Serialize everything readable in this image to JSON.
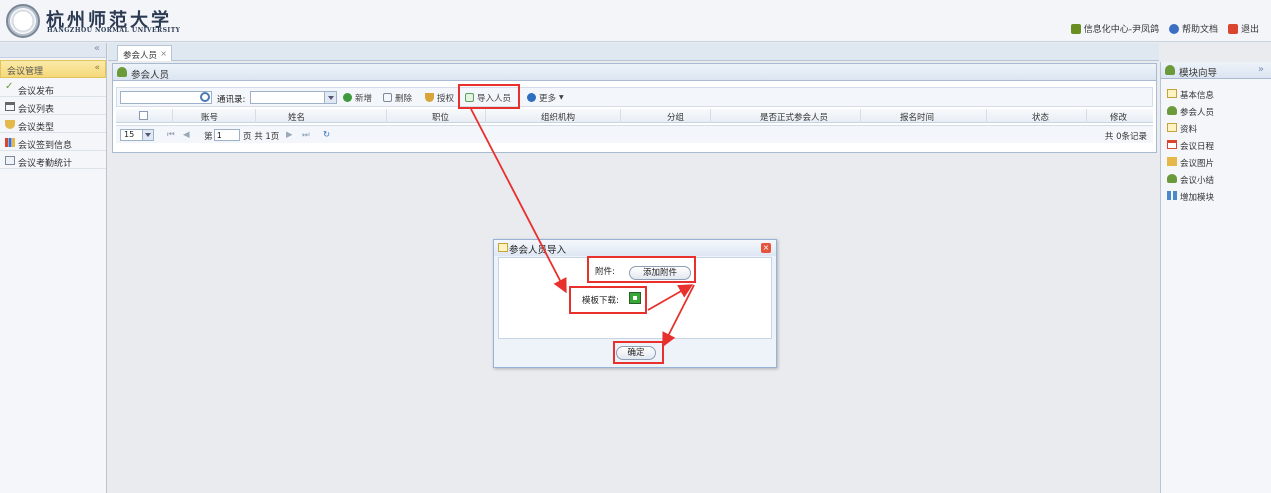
{
  "header": {
    "logo_cn": "杭州师范大学",
    "logo_en": "HANGZHOU NORMAL UNIVERSITY",
    "links": [
      {
        "label": "信息化中心-尹凤鸽",
        "icon": "user-icon",
        "color": "#6b8e23"
      },
      {
        "label": "帮助文档",
        "icon": "help-icon",
        "color": "#3a6fc4"
      },
      {
        "label": "退出",
        "icon": "exit-icon",
        "color": "#d9452f"
      }
    ]
  },
  "left_sidebar": {
    "collapse": "«",
    "section": "会议管理",
    "section_toggle": "«",
    "items": [
      {
        "label": "会议发布",
        "icon": "check-icon"
      },
      {
        "label": "会议列表",
        "icon": "building-icon"
      },
      {
        "label": "会议类型",
        "icon": "shield-icon"
      },
      {
        "label": "会议签到信息",
        "icon": "bar-chart-icon"
      },
      {
        "label": "会议考勤统计",
        "icon": "report-icon"
      }
    ]
  },
  "tabs": [
    {
      "label": "参会人员",
      "close": "×"
    }
  ],
  "panel": {
    "title": "参会人员",
    "toolbar": {
      "search_value": "",
      "address_label": "通讯录:",
      "address_value": "",
      "buttons": [
        {
          "label": "新增",
          "icon": "add-icon",
          "color": "#3d9a3d"
        },
        {
          "label": "删除",
          "icon": "delete-icon",
          "color": "#7d8a99"
        },
        {
          "label": "授权",
          "icon": "shield-icon",
          "color": "#d7a53a"
        },
        {
          "label": "导入人员",
          "icon": "import-icon",
          "color": "#5aa05a"
        },
        {
          "label": "更多",
          "icon": "more-icon",
          "color": "#2f6fc0"
        }
      ],
      "more_arrow": "▼"
    },
    "columns": [
      "账号",
      "姓名",
      "职位",
      "组织机构",
      "分组",
      "是否正式参会人员",
      "报名时间",
      "状态",
      "修改"
    ],
    "pager": {
      "page_size": "15",
      "first": "⏮",
      "prev": "◀",
      "page_label_before": "第",
      "page_value": "1",
      "page_label_after": "页 共 1页",
      "next": "▶",
      "last": "⏭",
      "refresh": "↻",
      "records": "共 0条记录"
    }
  },
  "right_sidebar": {
    "title": "模块向导",
    "collapse": "»",
    "items": [
      {
        "label": "基本信息",
        "icon": "info-icon",
        "color": "#e6c45c"
      },
      {
        "label": "参会人员",
        "icon": "users-icon",
        "color": "#6b9a3a"
      },
      {
        "label": "资料",
        "icon": "folder-icon",
        "color": "#e6c45c"
      },
      {
        "label": "会议日程",
        "icon": "calendar-icon",
        "color": "#d9452f"
      },
      {
        "label": "会议图片",
        "icon": "image-icon",
        "color": "#e6b84a"
      },
      {
        "label": "会议小结",
        "icon": "summary-icon",
        "color": "#6b9a3a"
      },
      {
        "label": "增加模块",
        "icon": "module-icon",
        "color": "#4a8ac9"
      }
    ]
  },
  "dialog": {
    "title": "参会人员导入",
    "close": "×",
    "attachment_label": "附件:",
    "attachment_button": "添加附件",
    "template_label": "模板下载:",
    "template_icon": "download-icon",
    "ok_button": "确定"
  },
  "annotation_color": "#e8302c"
}
